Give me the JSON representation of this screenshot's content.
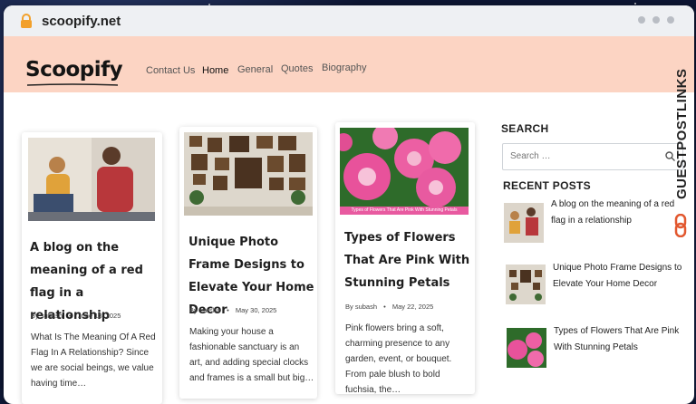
{
  "browser": {
    "url": "scoopify.net"
  },
  "site": {
    "logo": "Scoopify",
    "nav": [
      "Contact Us",
      "Home",
      "General",
      "Quotes",
      "Biography"
    ]
  },
  "posts": [
    {
      "title": "A blog on the meaning of a red flag in a relationship",
      "author": "subash",
      "date": "June 13, 2025",
      "excerpt": "What Is The Meaning Of A Red Flag In A Relationship? Since we are social beings, we value having time…"
    },
    {
      "title": "Unique Photo Frame Designs to Elevate Your Home Decor",
      "author": "Varsha",
      "date": "May 30, 2025",
      "excerpt": "Making your house a fashionable sanctuary is an art, and adding special clocks and frames is a small but big…"
    },
    {
      "title": "Types of Flowers That Are Pink With Stunning Petals",
      "author": "subash",
      "date": "May 22, 2025",
      "excerpt": "Pink flowers bring a soft, charming presence to any garden, event, or bouquet. From pale blush to bold fuchsia, the…",
      "image_caption": "Types of Flowers That Are Pink With Stunning Petals"
    }
  ],
  "sidebar": {
    "search_heading": "SEARCH",
    "search_placeholder": "Search …",
    "recent_heading": "RECENT POSTS",
    "recent": [
      "A blog on the meaning of a red flag in a relationship",
      "Unique Photo Frame Designs to Elevate Your Home Decor",
      "Types of Flowers That Are Pink With Stunning Petals"
    ]
  },
  "watermark": "GUESTPOSTLINKS",
  "colors": {
    "header_bg": "#fcd4c3",
    "accent": "#e2582f",
    "space_bg": "#0d1634"
  }
}
